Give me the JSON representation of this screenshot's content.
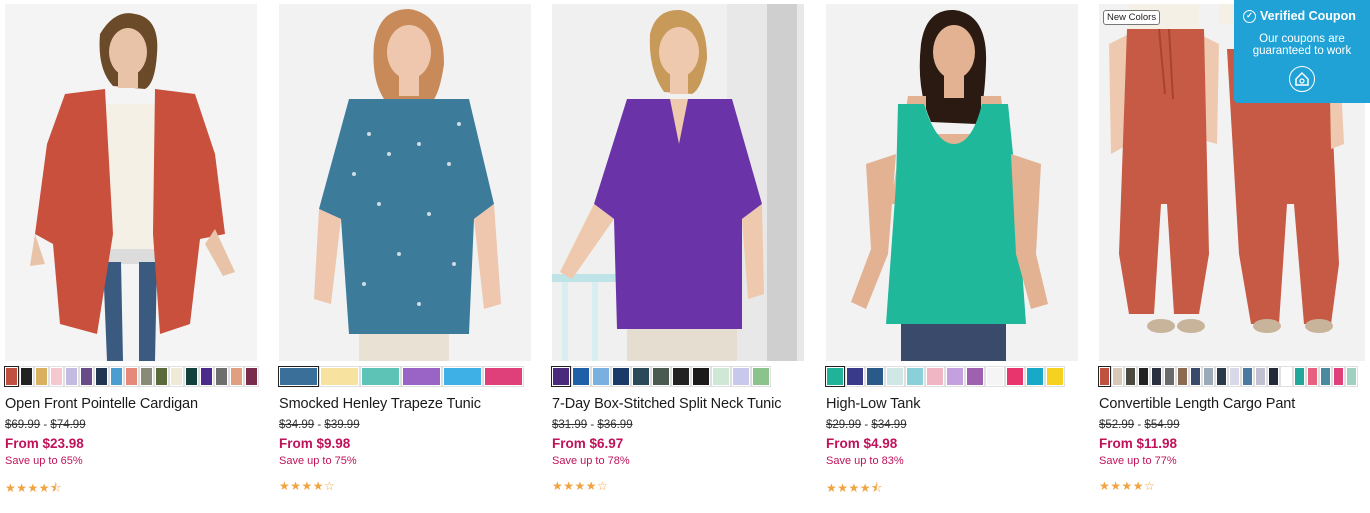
{
  "products": [
    {
      "name": "Open Front Pointelle Cardigan",
      "orig_low": "$69.99",
      "orig_high": "$74.99",
      "sale": "From $23.98",
      "save": "Save up to 65%",
      "rating": 4.5,
      "stars": "★★★★⯪",
      "swatches": [
        "#c0503f",
        "#222222",
        "#d8b060",
        "#f5c7cf",
        "#c3bce0",
        "#6a4b8a",
        "#1f3550",
        "#4a9ed0",
        "#e58a7a",
        "#8a8a78",
        "#5a6a3a",
        "#efe9d8",
        "#12403a",
        "#4a2a8a",
        "#6e6e6e",
        "#e0a080",
        "#7a2a4a"
      ],
      "photo": {
        "bg": "#f4f4f4",
        "garment": "#c9503d",
        "inner": "#f5f0e6",
        "skin": "#e8c3a8",
        "hair": "#6b4a2a",
        "legs": "#3a5a80"
      }
    },
    {
      "name": "Smocked Henley Trapeze Tunic",
      "orig_low": "$34.99",
      "orig_high": "$39.99",
      "sale": "From $9.98",
      "save": "Save up to 75%",
      "rating": 4,
      "stars": "★★★★☆",
      "swatches": [
        "#3a6f9a",
        "#f8e2a0",
        "#5ec3b7",
        "#9a63c6",
        "#3fb0e6",
        "#e0407a"
      ],
      "photo": {
        "bg": "#f2f2f2",
        "garment": "#3d7b9a",
        "inner": "#3d7b9a",
        "skin": "#eec7ae",
        "hair": "#c98a5a",
        "legs": "#e9e2d4"
      }
    },
    {
      "name": "7-Day Box-Stitched Split Neck Tunic",
      "orig_low": "$31.99",
      "orig_high": "$36.99",
      "sale": "From $6.97",
      "save": "Save up to 78%",
      "rating": 4,
      "stars": "★★★★☆",
      "swatches": [
        "#4a2a7a",
        "#1e5fa8",
        "#7ab0e0",
        "#1a3a6a",
        "#2a4a5a",
        "#4a5a50",
        "#222222",
        "#1a1a1a",
        "#cfe8d6",
        "#c8c8ec",
        "#8ac48a"
      ],
      "photo": {
        "bg": "#f0f0f0",
        "garment": "#6b33a8",
        "inner": "#f5f0e6",
        "skin": "#efc9ad",
        "hair": "#c79a5a",
        "legs": "#e5ddd0"
      }
    },
    {
      "name": "High-Low Tank",
      "orig_low": "$29.99",
      "orig_high": "$34.99",
      "sale": "From $4.98",
      "save": "Save up to 83%",
      "rating": 4.5,
      "stars": "★★★★⯪",
      "swatches": [
        "#21b39a",
        "#3a3a8a",
        "#2a5a8a",
        "#cfe8e6",
        "#8ad0d8",
        "#f0b6c4",
        "#c4a0e0",
        "#a060b0",
        "#f5f5f5",
        "#e8356e",
        "#18a9c9",
        "#f5d21f"
      ],
      "photo": {
        "bg": "#f2f2f2",
        "garment": "#1fb89a",
        "inner": "#1fb89a",
        "skin": "#e2b292",
        "hair": "#2a1a12",
        "legs": "#3a4a6a"
      }
    },
    {
      "name": "Convertible Length Cargo Pant",
      "orig_low": "$52.99",
      "orig_high": "$54.99",
      "sale": "From $11.98",
      "save": "Save up to 77%",
      "rating": 4,
      "stars": "★★★★☆",
      "badge": "New Colors",
      "swatches": [
        "#c0503f",
        "#d8c8b8",
        "#4a4a40",
        "#222222",
        "#2a3040",
        "#6a6a6a",
        "#8a6a50",
        "#3a4a6a",
        "#9aaab8",
        "#2a3a4a",
        "#d8d8e8",
        "#4a7aa0",
        "#c0c0d0",
        "#222a3a",
        "#ffffff",
        "#21a89a",
        "#e86080",
        "#4a8aa0",
        "#e0407a",
        "#a0d0c0"
      ],
      "photo": {
        "bg": "#f2f2f2",
        "garment": "#c65a44",
        "inner": "#f5f0e6",
        "skin": "#eec9b0",
        "hair": "#eec9b0",
        "legs": "#c65a44"
      }
    }
  ],
  "verified_coupon": {
    "title": "Verified Coupon",
    "text_line1": "Our coupons are",
    "text_line2": "guaranteed to work",
    "color": "#21a2d6"
  }
}
